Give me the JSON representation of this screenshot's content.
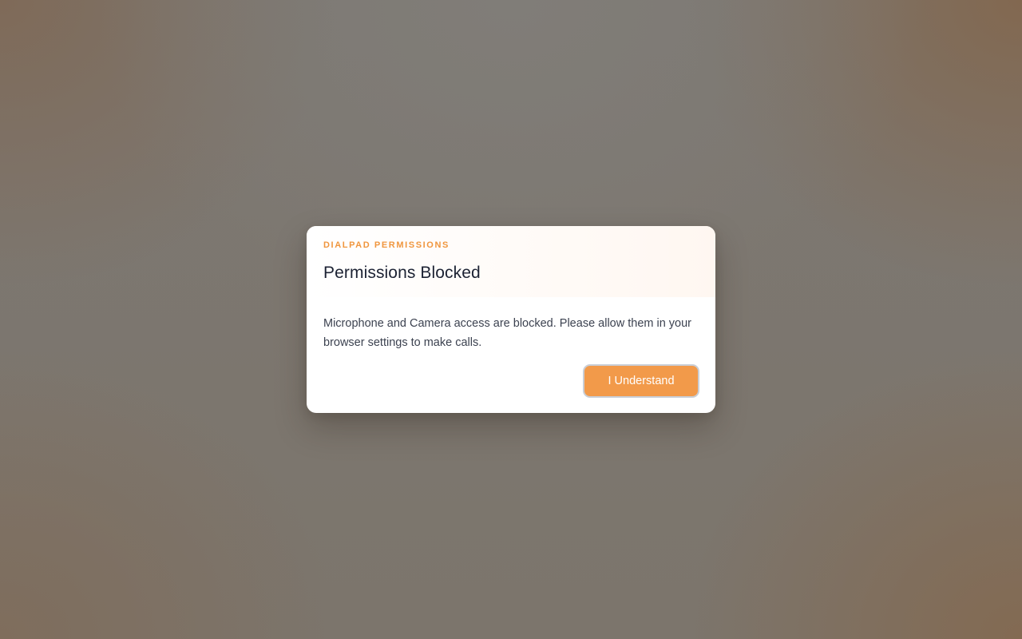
{
  "dialog": {
    "eyebrow": "DIALPAD PERMISSIONS",
    "title": "Permissions Blocked",
    "message": "Microphone and Camera access are blocked. Please allow them in your browser settings to make calls.",
    "confirm_label": "I Understand"
  },
  "colors": {
    "accent": "#f29a4a",
    "eyebrow": "#f0963e",
    "title": "#1c2233",
    "body_text": "#3c4250"
  }
}
